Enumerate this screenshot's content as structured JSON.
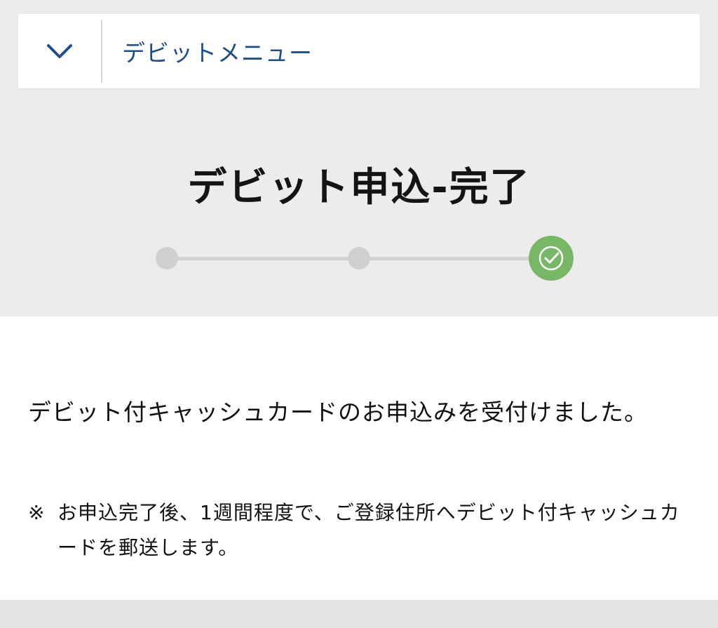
{
  "header": {
    "menu_label": "デビットメニュー",
    "toggle_icon": "chevron-down-icon"
  },
  "page": {
    "title": "デビット申込-完了"
  },
  "steps": {
    "total": 3,
    "current": 3,
    "completed_icon": "check-circle-icon",
    "colors": {
      "completed": "#77b866",
      "pending": "#cfcfcf"
    }
  },
  "content": {
    "message": "デビット付キャッシュカードのお申込みを受付けました。",
    "note_mark": "※",
    "note_text": "お申込完了後、1週間程度で、ご登録住所へデビット付キャッシュカードを郵送します。"
  },
  "colors": {
    "accent": "#1f4e8c",
    "background": "#ececec"
  }
}
